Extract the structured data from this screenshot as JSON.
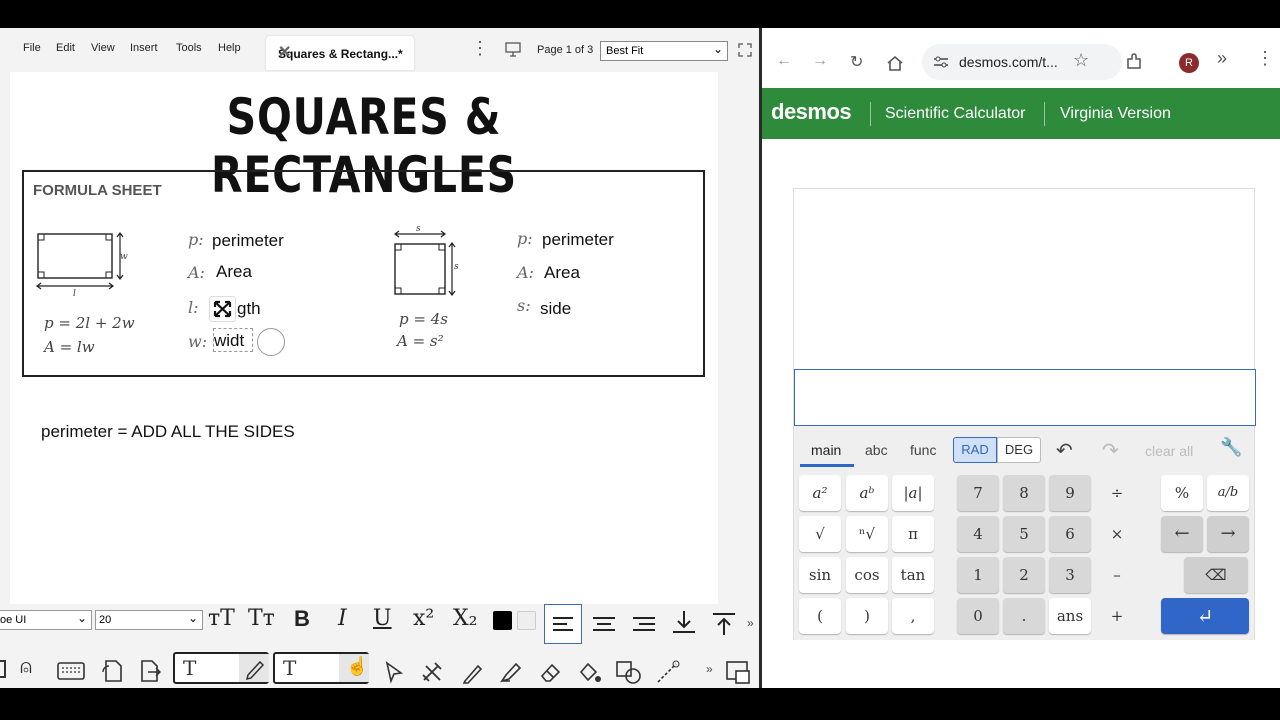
{
  "left_app": {
    "menu": [
      "File",
      "Edit",
      "View",
      "Insert",
      "Tools",
      "Help"
    ],
    "doc_tab": "Squares & Rectang...*",
    "page_indicator": "Page 1 of 3",
    "zoom": "Best Fit",
    "document": {
      "title": "SQUARES & RECTANGLES",
      "formula_sheet_title": "FORMULA SHEET",
      "rect_dim_w": "w",
      "rect_dim_l": "l",
      "rect_formula_p": "p = 2l + 2w",
      "rect_formula_a": "A = lw",
      "rect_labels": [
        {
          "var": "p:",
          "word": "perimeter"
        },
        {
          "var": "A:",
          "word": "Area"
        },
        {
          "var": "l:",
          "word": "gth"
        },
        {
          "var": "w:",
          "word": "widt"
        }
      ],
      "sq_dim_top": "s",
      "sq_dim_side": "s",
      "sq_formula_p": "p = 4s",
      "sq_formula_a": "A = s²",
      "sq_labels": [
        {
          "var": "p:",
          "word": "perimeter"
        },
        {
          "var": "A:",
          "word": "Area"
        },
        {
          "var": "s:",
          "word": "side"
        }
      ],
      "perimeter_note": "perimeter = ADD ALL THE SIDES"
    },
    "toolbar": {
      "font_family": "oe UI",
      "font_size": "20",
      "bold": "B",
      "italic": "I",
      "underline": "U"
    }
  },
  "right_app": {
    "url": "desmos.com/t...",
    "avatar_initial": "R",
    "brand": "desmos",
    "nav": [
      "Scientific Calculator",
      "Virginia Version"
    ],
    "keyboard": {
      "tabs": [
        "main",
        "abc",
        "func"
      ],
      "angle_modes": [
        "RAD",
        "DEG"
      ],
      "active_tab": "main",
      "active_angle": "RAD",
      "clear_all": "clear all",
      "rows": [
        [
          "a²",
          "aᵇ",
          "|a|",
          "7",
          "8",
          "9",
          "÷",
          "%",
          "a/b"
        ],
        [
          "√",
          "ⁿ√",
          "π",
          "4",
          "5",
          "6",
          "×",
          "←",
          "→"
        ],
        [
          "sin",
          "cos",
          "tan",
          "1",
          "2",
          "3",
          "–",
          "⌫"
        ],
        [
          "(",
          ")",
          ",",
          "0",
          ".",
          "ans",
          "+",
          "↵"
        ]
      ]
    }
  },
  "colors": {
    "desmos_green": "#2f8b3c",
    "desmos_blue": "#2f66c8"
  }
}
